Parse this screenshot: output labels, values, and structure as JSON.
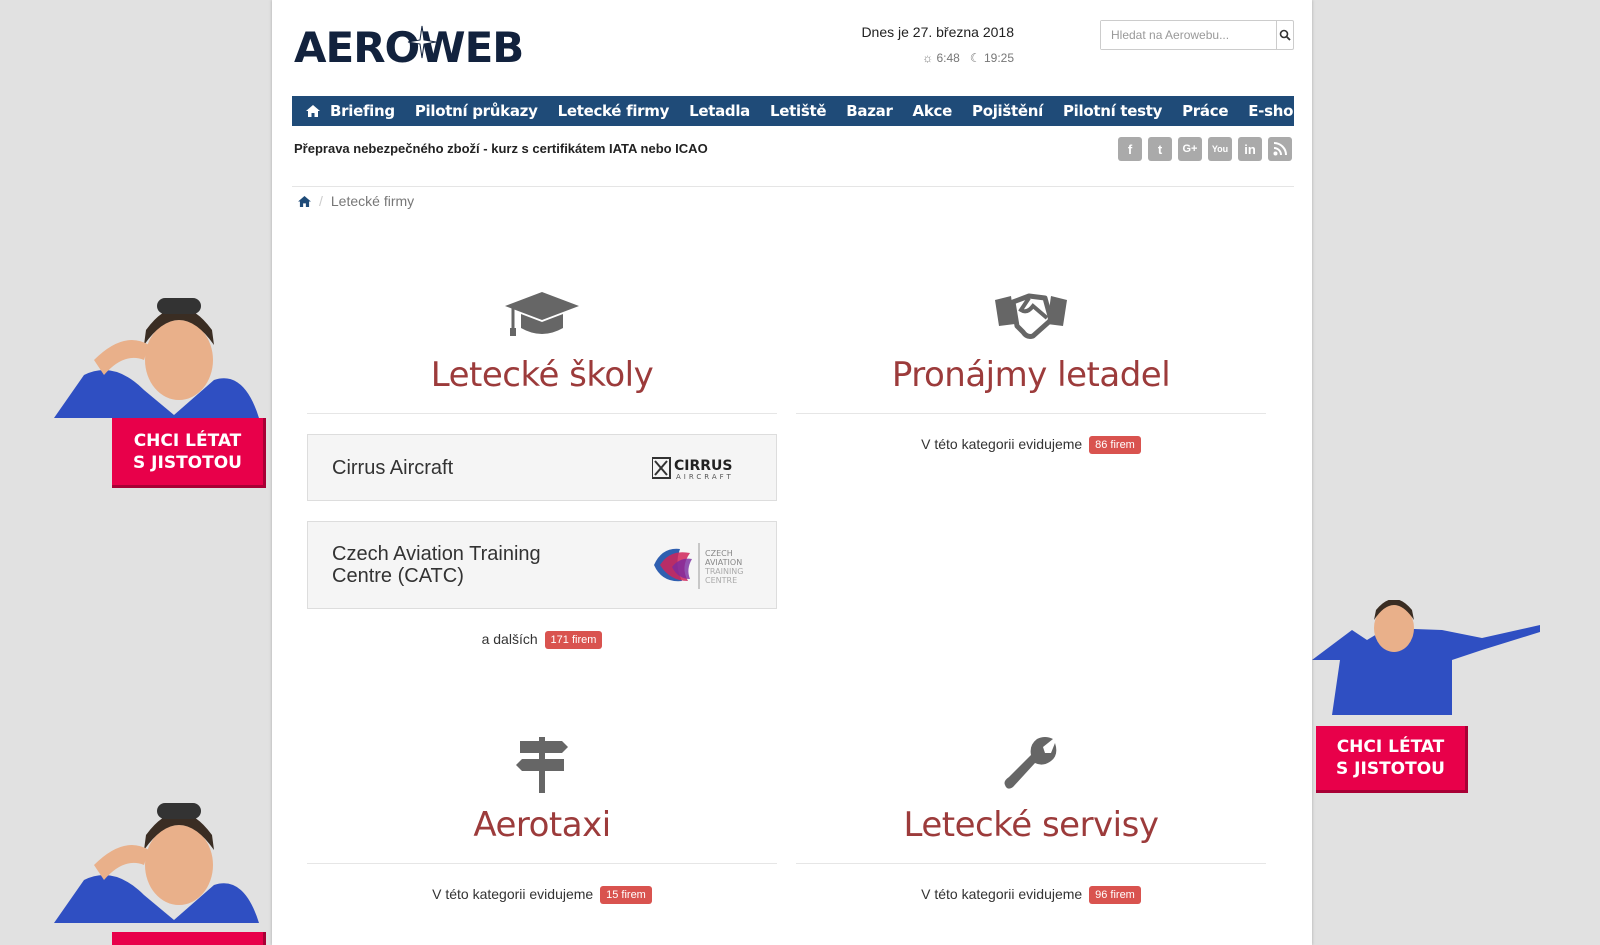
{
  "ads": {
    "left_top_label_line1": "CHCI LÉTAT",
    "left_top_label_line2": "S JISTOTOU",
    "right_label_line1": "CHCI LÉTAT",
    "right_label_line2": "S JISTOTOU"
  },
  "header": {
    "logo_text": "AEROWEB",
    "date": "Dnes je 27. března 2018",
    "sunrise": "6:48",
    "sunset": "19:25",
    "search_placeholder": "Hledat na Aerowebu..."
  },
  "nav": {
    "items": [
      "Briefing",
      "Pilotní průkazy",
      "Letecké firmy",
      "Letadla",
      "Letiště",
      "Bazar",
      "Akce",
      "Pojištění",
      "Pilotní testy",
      "Práce",
      "E-shop"
    ]
  },
  "promo": "Přeprava nebezpečného zboží - kurz s certifikátem IATA nebo ICAO",
  "social": [
    "facebook-icon",
    "twitter-icon",
    "google-plus-icon",
    "youtube-icon",
    "linkedin-icon",
    "rss-icon"
  ],
  "breadcrumb": {
    "current": "Letecké firmy"
  },
  "categories": {
    "schools": {
      "title": "Letecké školy",
      "cards": [
        {
          "name": "Cirrus Aircraft",
          "logo_line1": "CIRRUS",
          "logo_line2": "AIRCRAFT"
        },
        {
          "name": "Czech Aviation Training Centre (CATC)",
          "logo_line1": "CZECH",
          "logo_line2": "AVIATION",
          "logo_line3": "TRAINING",
          "logo_line4": "CENTRE"
        }
      ],
      "more_prefix": "a dalších",
      "badge": "171 firem"
    },
    "rentals": {
      "title": "Pronájmy letadel",
      "count_prefix": "V této kategorii evidujeme",
      "badge": "86 firem"
    },
    "taxi": {
      "title": "Aerotaxi",
      "count_prefix": "V této kategorii evidujeme",
      "badge": "15 firem"
    },
    "service": {
      "title": "Letecké servisy",
      "count_prefix": "V této kategorii evidujeme",
      "badge": "96 firem"
    }
  },
  "colors": {
    "nav": "#1f4b78",
    "title": "#9c3b3b",
    "badge": "#d9534f",
    "ad": "#e8004a"
  }
}
